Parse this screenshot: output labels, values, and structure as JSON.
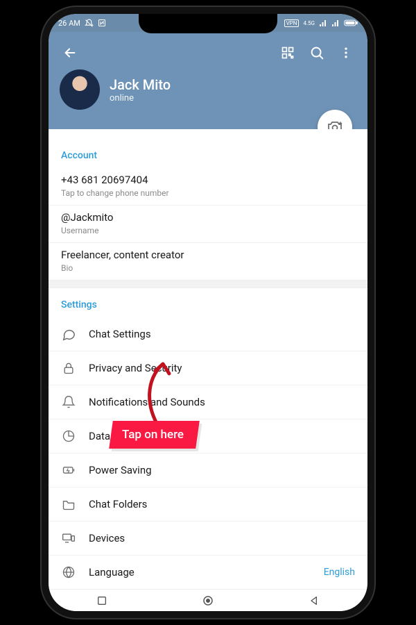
{
  "statusbar": {
    "time": "26 AM",
    "net_label": "4.5G",
    "vpn": "VPN"
  },
  "header": {
    "name": "Jack Mito",
    "status": "online"
  },
  "account": {
    "section": "Account",
    "phone": "+43 681 20697404",
    "phone_sub": "Tap to change phone number",
    "username": "@Jackmito",
    "username_sub": "Username",
    "bio": "Freelancer, content creator",
    "bio_sub": "Bio"
  },
  "settings": {
    "section": "Settings",
    "items": [
      {
        "label": "Chat Settings"
      },
      {
        "label": "Privacy and Security"
      },
      {
        "label": "Notifications and Sounds"
      },
      {
        "label": "Data and Storage"
      },
      {
        "label": "Power Saving"
      },
      {
        "label": "Chat Folders"
      },
      {
        "label": "Devices"
      },
      {
        "label": "Language",
        "value": "English"
      }
    ]
  },
  "annotation": {
    "text": "Tap on here"
  }
}
